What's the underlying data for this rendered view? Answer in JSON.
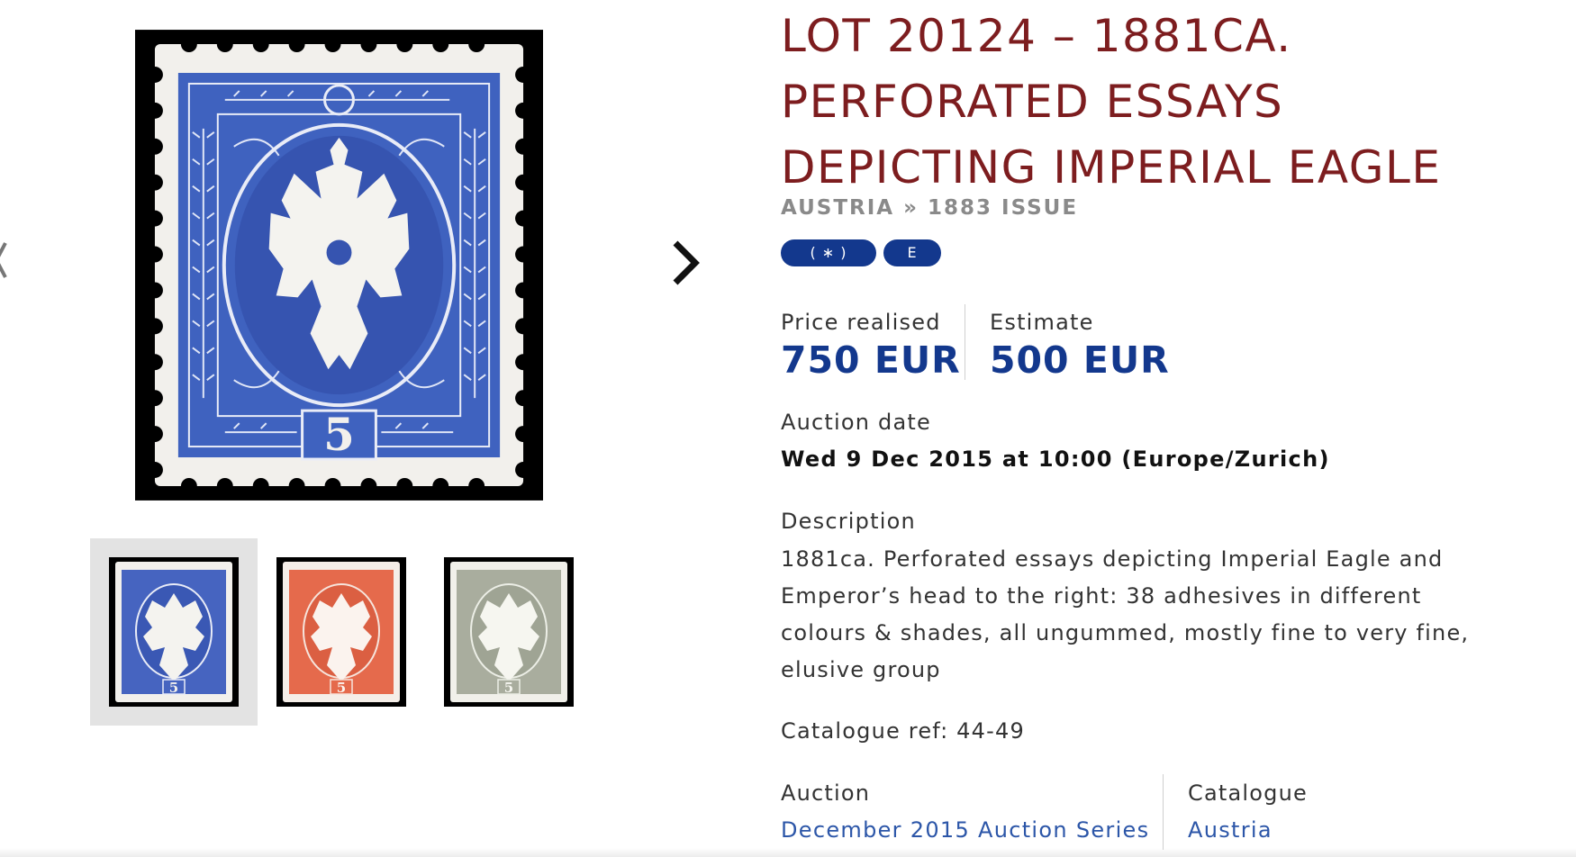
{
  "gallery": {
    "main_image": {
      "color": "#3f62bf",
      "value_numeral": "5"
    },
    "thumbnails": [
      {
        "color": "#4664c0",
        "selected": true
      },
      {
        "color": "#e56a4c",
        "selected": false
      },
      {
        "color": "#a9ad9e",
        "selected": false
      }
    ],
    "prev_icon": "chevron-left-icon",
    "next_icon": "chevron-right-icon"
  },
  "lot": {
    "title_lines": [
      "LOT 20124 – 1881CA.",
      "PERFORATED ESSAYS",
      "DEPICTING IMPERIAL EAGLE"
    ],
    "breadcrumb": {
      "country": "AUSTRIA",
      "separator": "»",
      "issue": "1883 ISSUE"
    },
    "badges": [
      "( ∗ )",
      "E"
    ],
    "price_realised_label": "Price realised",
    "price_realised_value": "750 EUR",
    "estimate_label": "Estimate",
    "estimate_value": "500 EUR",
    "auction_date_label": "Auction date",
    "auction_date_value": "Wed 9 Dec 2015 at 10:00 (Europe/Zurich)",
    "description_label": "Description",
    "description_text": "1881ca. Perforated essays depicting Imperial Eagle and Emperor’s head to the right: 38 adhesives in different colours & shades, all ungummed, mostly fine to very fine, elusive group",
    "catalogue_ref": "Catalogue ref: 44-49",
    "auction_label": "Auction",
    "auction_value": "December 2015 Auction Series",
    "catalogue_label": "Catalogue",
    "catalogue_value": "Austria"
  },
  "colors": {
    "title": "#7d1d1f",
    "accent_blue": "#13388d",
    "link_blue": "#2c56a8"
  }
}
